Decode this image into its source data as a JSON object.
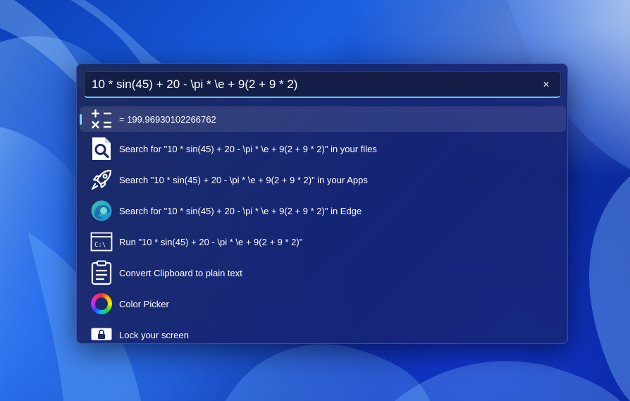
{
  "search": {
    "query": "10 * sin(45) + 20 - \\pi * \\e + 9(2 + 9 * 2)",
    "clear_symbol": "✕"
  },
  "results": [
    {
      "label": "= 199.96930102266762",
      "icon": "calculator-icon",
      "selected": true
    },
    {
      "label": "Search for \"10 * sin(45) + 20 - \\pi * \\e + 9(2 + 9 * 2)\" in your files",
      "icon": "file-search-icon"
    },
    {
      "label": "Search \"10 * sin(45) + 20 - \\pi * \\e + 9(2 + 9 * 2)\" in your Apps",
      "icon": "rocket-icon"
    },
    {
      "label": "Search for \"10 * sin(45) + 20 - \\pi * \\e + 9(2 + 9 * 2)\" in Edge",
      "icon": "edge-icon"
    },
    {
      "label": "Run \"10 * sin(45) + 20 - \\pi * \\e + 9(2 + 9 * 2)\"",
      "icon": "terminal-icon"
    },
    {
      "label": "Convert Clipboard to plain text",
      "icon": "clipboard-icon"
    },
    {
      "label": "Color Picker",
      "icon": "color-wheel-icon"
    },
    {
      "label": "Lock your screen",
      "icon": "lock-icon"
    }
  ],
  "colors": {
    "accent": "#5cc8f5",
    "text": "#ffffff"
  }
}
